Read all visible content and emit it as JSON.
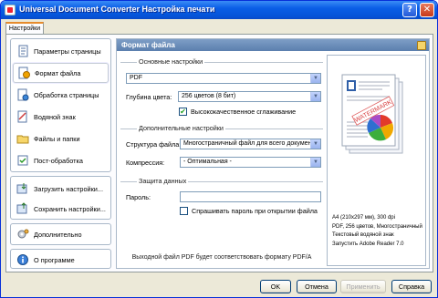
{
  "window": {
    "title": "Universal Document Converter Настройка печати"
  },
  "tabs": [
    {
      "label": "Настройки"
    }
  ],
  "sidebar": {
    "items": [
      {
        "label": "Параметры страницы",
        "icon": "page-settings-icon"
      },
      {
        "label": "Формат файла",
        "icon": "file-format-icon",
        "active": true
      },
      {
        "label": "Обработка страницы",
        "icon": "page-processing-icon"
      },
      {
        "label": "Водяной знак",
        "icon": "watermark-icon"
      },
      {
        "label": "Файлы и папки",
        "icon": "folder-icon"
      },
      {
        "label": "Пост-обработка",
        "icon": "post-processing-icon"
      },
      {
        "label": "Загрузить настройки...",
        "icon": "load-settings-icon"
      },
      {
        "label": "Сохранить настройки...",
        "icon": "save-settings-icon"
      },
      {
        "label": "Дополнительно",
        "icon": "advanced-icon"
      },
      {
        "label": "О программе",
        "icon": "about-icon"
      }
    ]
  },
  "content": {
    "title": "Формат файла",
    "basic": {
      "title": "Основные настройки",
      "format_value": "PDF",
      "color_depth_label": "Глубина цвета:",
      "color_depth_value": "256 цветов (8 бит)",
      "smoothing_label": "Высококачественное сглаживание",
      "smoothing_checked": true
    },
    "extra": {
      "title": "Дополнительные настройки",
      "structure_label": "Структура файла:",
      "structure_value": "Многостраничный файл для всего документа",
      "compression_label": "Компрессия:",
      "compression_value": "- Оптимальная -"
    },
    "protection": {
      "title": "Защита данных",
      "password_label": "Пароль:",
      "password_value": "",
      "ask_label": "Спрашивать пароль при открытии файла",
      "ask_checked": false
    },
    "note": "Выходной файл PDF будет соответствовать формату PDF/A"
  },
  "preview": {
    "watermark_text": "WATERMARK",
    "info": [
      "A4 (210x297 мм), 300 dpi",
      "PDF, 256 цветов, Многостраничный",
      "Текстовый водяной знак",
      "Запустить Adobe Reader 7.0"
    ]
  },
  "buttons": {
    "ok": "OK",
    "cancel": "Отмена",
    "apply": "Применить",
    "help": "Справка"
  },
  "colors": {
    "titlebar": "#0a5ee6",
    "section_header": "#6a8dbb",
    "tab_accent": "#e68b2c"
  }
}
